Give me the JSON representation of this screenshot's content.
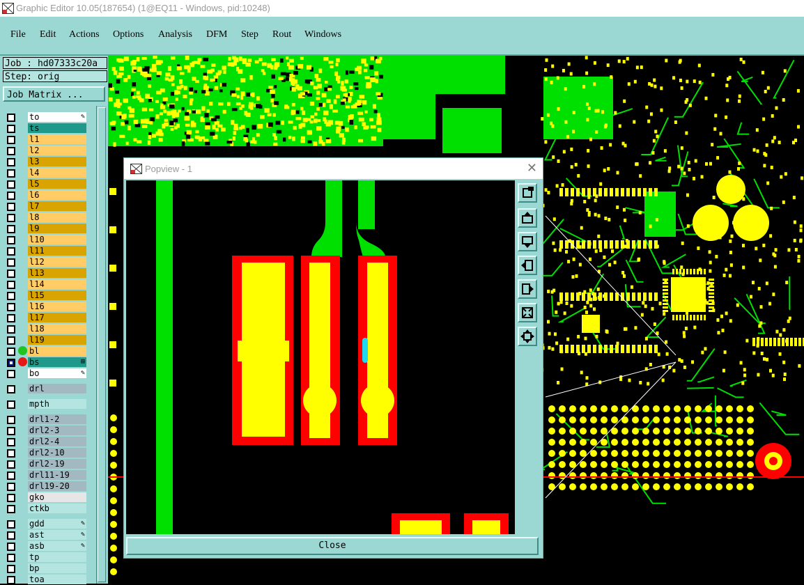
{
  "window": {
    "title": "Graphic Editor 10.05(187654) (1@EQ11 - Windows, pid:10248)"
  },
  "menu": [
    "File",
    "Edit",
    "Actions",
    "Options",
    "Analysis",
    "DFM",
    "Step",
    "Rout",
    "Windows"
  ],
  "job": {
    "job_line": "Job : hd07333c20a",
    "step_line": "Step: orig",
    "matrix_label": "Job Matrix ..."
  },
  "layers": [
    {
      "name": "to",
      "color": "#ffffff",
      "mark": "✎"
    },
    {
      "name": "ts",
      "color": "#1f9a8a"
    },
    {
      "name": "l1",
      "color": "#ffcc66"
    },
    {
      "name": "l2",
      "color": "#ffcc66"
    },
    {
      "name": "l3",
      "color": "#d9a400"
    },
    {
      "name": "l4",
      "color": "#ffcc66"
    },
    {
      "name": "l5",
      "color": "#d9a400"
    },
    {
      "name": "l6",
      "color": "#ffcc66"
    },
    {
      "name": "l7",
      "color": "#d9a400"
    },
    {
      "name": "l8",
      "color": "#ffcc66"
    },
    {
      "name": "l9",
      "color": "#d9a400"
    },
    {
      "name": "l10",
      "color": "#ffcc66"
    },
    {
      "name": "l11",
      "color": "#d9a400"
    },
    {
      "name": "l12",
      "color": "#ffcc66"
    },
    {
      "name": "l13",
      "color": "#d9a400"
    },
    {
      "name": "l14",
      "color": "#ffcc66"
    },
    {
      "name": "l15",
      "color": "#d9a400"
    },
    {
      "name": "l16",
      "color": "#ffcc66"
    },
    {
      "name": "l17",
      "color": "#d9a400"
    },
    {
      "name": "l18",
      "color": "#ffcc66"
    },
    {
      "name": "l19",
      "color": "#d9a400"
    },
    {
      "name": "bl",
      "color": "#ffcc66",
      "dot": "#22c422"
    },
    {
      "name": "bs",
      "color": "#1f9a8a",
      "dot": "#e81818",
      "checked": true,
      "mark": "⊞"
    },
    {
      "name": "bo",
      "color": "#ffffff",
      "mark": "✎"
    },
    {
      "name": "drl",
      "color": "#a3b9c2",
      "gap": true
    },
    {
      "name": "mpth",
      "color": "#b5e5e1",
      "gap": true
    },
    {
      "name": "drl1-2",
      "color": "#a3b9c2",
      "gap": true
    },
    {
      "name": "drl2-3",
      "color": "#a3b9c2"
    },
    {
      "name": "drl2-4",
      "color": "#a3b9c2"
    },
    {
      "name": "drl2-10",
      "color": "#a3b9c2"
    },
    {
      "name": "drl2-19",
      "color": "#a3b9c2"
    },
    {
      "name": "drl11-19",
      "color": "#a3b9c2"
    },
    {
      "name": "drl19-20",
      "color": "#a3b9c2"
    },
    {
      "name": "gko",
      "color": "#e6e6e6"
    },
    {
      "name": "ctkb",
      "color": "#b5e5e1"
    },
    {
      "name": "gdd",
      "color": "#b5e5e1",
      "gap": true,
      "mark": "✎"
    },
    {
      "name": "ast",
      "color": "#b5e5e1",
      "mark": "✎"
    },
    {
      "name": "asb",
      "color": "#b5e5e1",
      "mark": "✎"
    },
    {
      "name": "tp",
      "color": "#b5e5e1"
    },
    {
      "name": "bp",
      "color": "#b5e5e1"
    },
    {
      "name": "toa",
      "color": "#b5e5e1"
    }
  ],
  "popup": {
    "title": "Popview - 1",
    "close_label": "Close"
  },
  "colors": {
    "pad_yellow": "#ffff00",
    "trace_green": "#00e000",
    "mask_red": "#ff0000",
    "panel_teal": "#9bd8d3",
    "selection_cyan": "#20d8f0"
  }
}
